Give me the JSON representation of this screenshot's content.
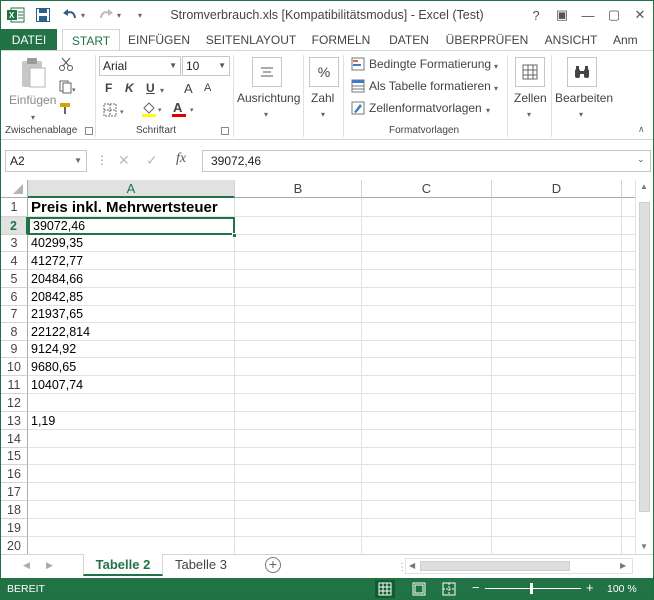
{
  "window": {
    "title": "Stromverbrauch.xls  [Kompatibilitätsmodus] - Excel (Test)",
    "help": "?",
    "restore_ribbon": "▣",
    "minimize": "—",
    "maximize": "▢",
    "close": "✕"
  },
  "tabs": [
    "DATEI",
    "START",
    "EINFÜGEN",
    "SEITENLAYOUT",
    "FORMELN",
    "DATEN",
    "ÜBERPRÜFEN",
    "ANSICHT",
    "Anm"
  ],
  "ribbon": {
    "clipboard": {
      "paste": "Einfügen",
      "group": "Zwischenablage"
    },
    "font": {
      "name": "Arial",
      "size": "10",
      "bold": "F",
      "italic": "K",
      "underline": "U",
      "grow": "A",
      "shrink": "A",
      "group": "Schriftart"
    },
    "alignment": {
      "label": "Ausrichtung"
    },
    "number": {
      "label": "Zahl"
    },
    "styles": {
      "conditional": "Bedingte Formatierung",
      "table": "Als Tabelle formatieren",
      "cellstyles": "Zellenformatvorlagen",
      "group": "Formatvorlagen"
    },
    "cells": {
      "label": "Zellen"
    },
    "editing": {
      "label": "Bearbeiten"
    }
  },
  "formula_bar": {
    "name_box": "A2",
    "fx": "fx",
    "value": "39072,46"
  },
  "columns": [
    "A",
    "B",
    "C",
    "D"
  ],
  "rows": [
    "1",
    "2",
    "3",
    "4",
    "5",
    "6",
    "7",
    "8",
    "9",
    "10",
    "11",
    "12",
    "13",
    "14",
    "15",
    "16",
    "17",
    "18",
    "19",
    "20"
  ],
  "cells_a": [
    "Preis inkl. Mehrwertsteuer",
    "39072,46",
    "40299,35",
    "41272,77",
    "20484,66",
    "20842,85",
    "21937,65",
    "22122,814",
    "9124,92",
    "9680,65",
    "10407,74",
    "",
    "1,19",
    "",
    "",
    "",
    "",
    "",
    "",
    ""
  ],
  "sheets": [
    "Tabelle 2",
    "Tabelle 3"
  ],
  "status": {
    "mode": "BEREIT",
    "zoom": "100 %"
  },
  "colors": {
    "accent": "#217346"
  }
}
